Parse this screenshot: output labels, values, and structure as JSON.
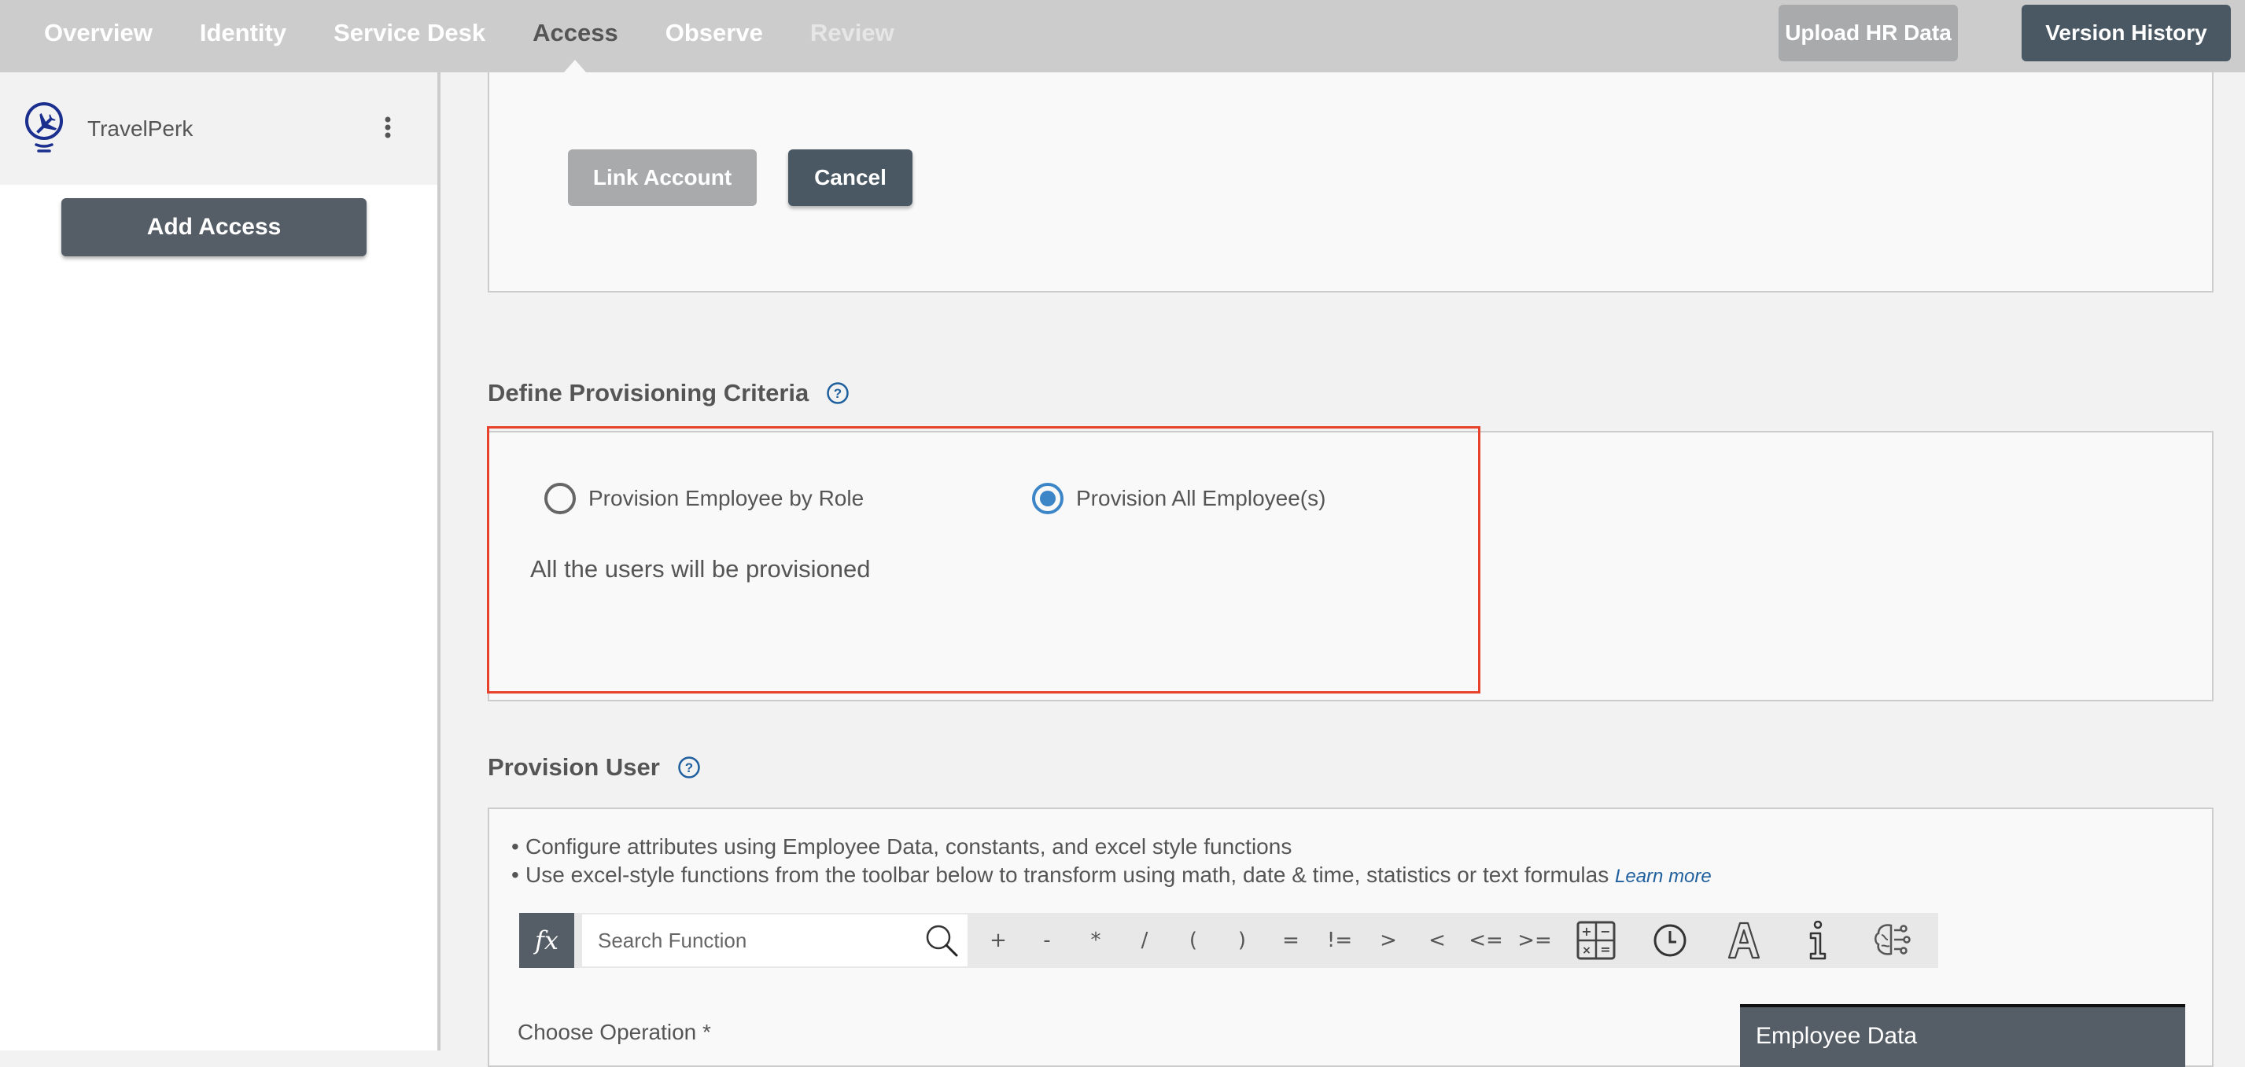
{
  "topnav": {
    "items": [
      {
        "label": "Overview",
        "state": "normal"
      },
      {
        "label": "Identity",
        "state": "normal"
      },
      {
        "label": "Service Desk",
        "state": "normal"
      },
      {
        "label": "Access",
        "state": "active"
      },
      {
        "label": "Observe",
        "state": "normal"
      },
      {
        "label": "Review",
        "state": "disabled"
      }
    ],
    "upload_label": "Upload HR Data",
    "version_label": "Version History"
  },
  "sidebar": {
    "app_name": "TravelPerk",
    "add_access_label": "Add Access"
  },
  "link_panel": {
    "link_label": "Link Account",
    "cancel_label": "Cancel"
  },
  "criteria": {
    "title": "Define Provisioning Criteria",
    "options": [
      {
        "label": "Provision Employee by Role",
        "selected": false
      },
      {
        "label": "Provision All Employee(s)",
        "selected": true
      }
    ],
    "message": "All the users will be provisioned",
    "highlight_color": "#e8412c"
  },
  "provision_user": {
    "title": "Provision User",
    "bullets": [
      "Configure attributes using Employee Data, constants, and excel style functions",
      "Use excel-style functions from the toolbar below to transform using math, date & time, statistics or text formulas"
    ],
    "learn_more": "Learn more",
    "toolbar": {
      "fx_label": "fx",
      "search_placeholder": "Search Function",
      "operators": [
        "+",
        "-",
        "*",
        "/",
        "(",
        ")",
        "=",
        "!=",
        ">",
        "<",
        "<=",
        ">="
      ],
      "icons": [
        "math-functions-icon",
        "clock-icon",
        "text-icon",
        "info-icon",
        "ai-brain-icon"
      ]
    },
    "choose_operation_label": "Choose Operation *",
    "employee_data_label": "Employee Data"
  },
  "colors": {
    "accent": "#3c86c8",
    "dark_button": "#4a5863",
    "disabled_button": "#a9aaac",
    "logo": "#1b2f8f"
  }
}
